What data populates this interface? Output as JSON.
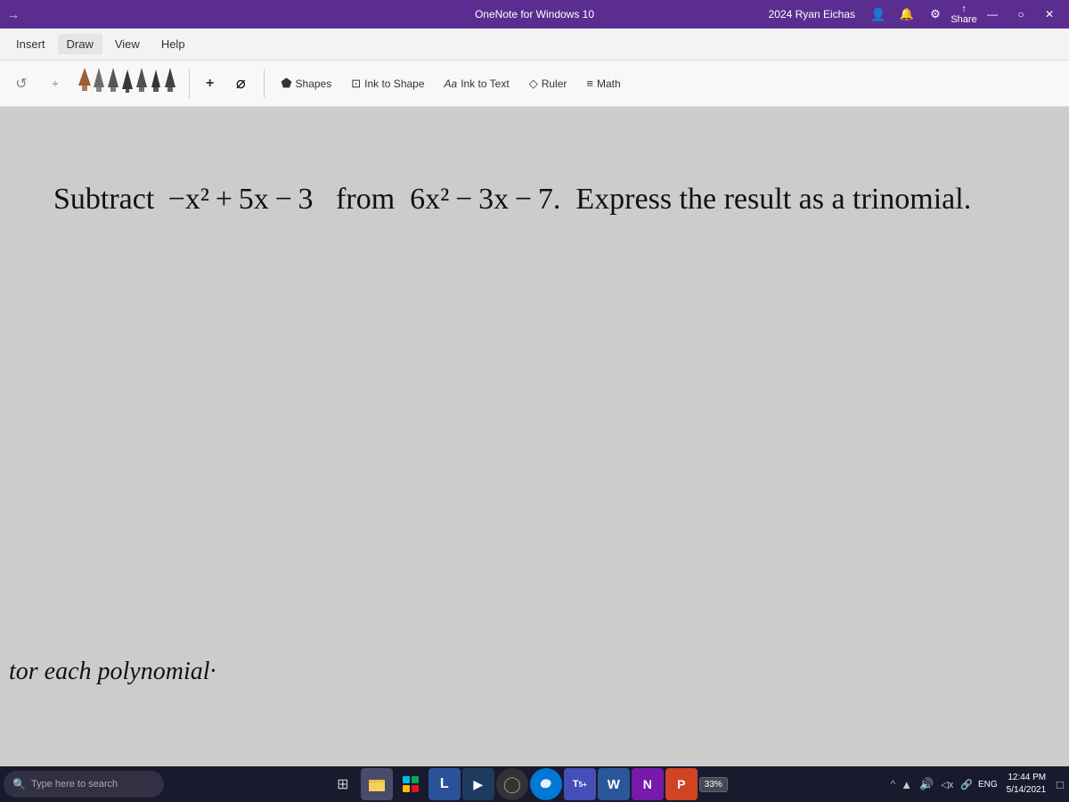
{
  "titlebar": {
    "title": "OneNote for Windows 10",
    "user": "2024 Ryan Eichas",
    "minimize": "—",
    "maximize": "○",
    "close": "✕",
    "back_arrow": "→"
  },
  "menubar": {
    "items": [
      "Insert",
      "Draw",
      "View",
      "Help"
    ]
  },
  "toolbar": {
    "shapes_label": "Shapes",
    "ink_to_shape_label": "Ink to Shape",
    "ink_to_text_label": "Ink to Text",
    "ruler_label": "Ruler",
    "math_label": "Math",
    "plus_label": "+",
    "lasso_label": "⌀"
  },
  "canvas": {
    "math_problem": "Subtract −x² + 5x − 3  from  6x² − 3x − 7.  Express the result as a trinomial.",
    "partial_bottom": "tor each polynomial·"
  },
  "taskbar": {
    "search_placeholder": "Type here to search",
    "time": "12:44 PM",
    "date": "5/14/2021",
    "language": "ENG",
    "battery": "33%",
    "apps": [
      {
        "icon": "⊞",
        "name": "windows-btn"
      },
      {
        "icon": "⊞",
        "name": "task-view"
      },
      {
        "icon": "🗂",
        "name": "file-explorer"
      },
      {
        "icon": "⠿",
        "name": "start-menu"
      },
      {
        "icon": "L",
        "name": "app-l"
      },
      {
        "icon": "▶",
        "name": "app-arrow"
      },
      {
        "icon": "◯",
        "name": "app-circle"
      },
      {
        "icon": "⊙",
        "name": "app-edge"
      },
      {
        "icon": "T",
        "name": "app-teams"
      },
      {
        "icon": "W",
        "name": "app-word"
      },
      {
        "icon": "N",
        "name": "app-onenote"
      },
      {
        "icon": "P",
        "name": "app-powerpoint"
      }
    ]
  },
  "colors": {
    "titlebar_bg": "#5c2d91",
    "menubar_bg": "#f3f3f3",
    "toolbar_bg": "#f8f8f8",
    "canvas_bg": "#cccccc",
    "taskbar_bg": "#1a1a2e"
  }
}
